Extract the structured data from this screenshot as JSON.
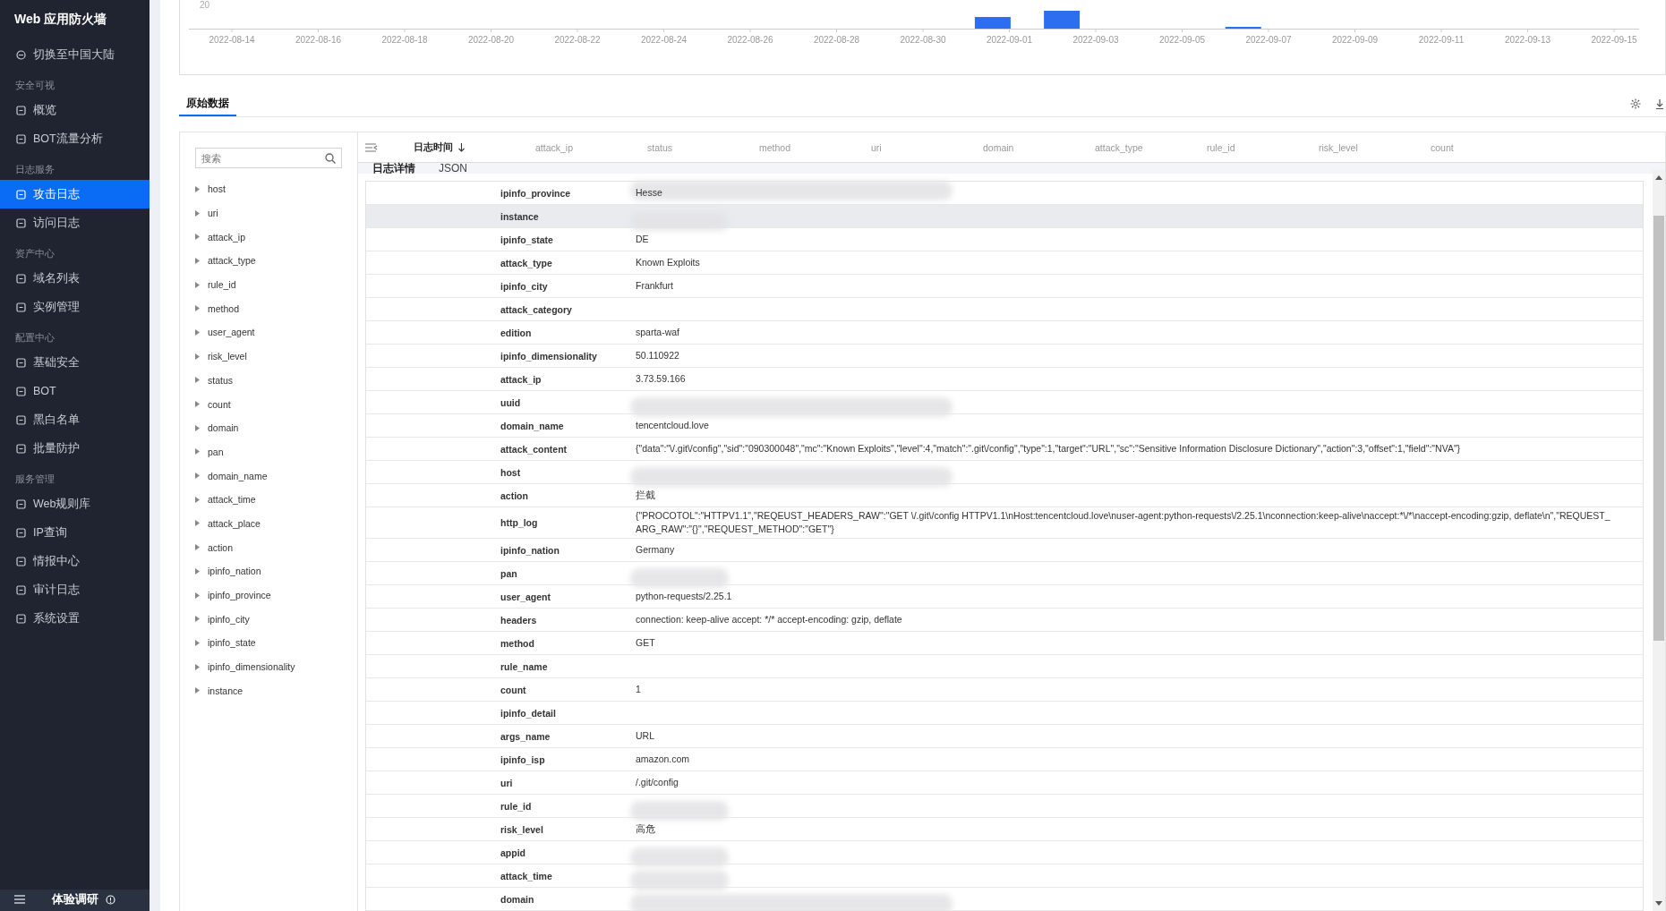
{
  "sidebar": {
    "title": "Web 应用防火墙",
    "switch_link": "切换至中国大陆",
    "groups": [
      {
        "heading": "安全可视",
        "items": [
          {
            "label": "概览",
            "selected": false
          },
          {
            "label": "BOT流量分析",
            "selected": false
          }
        ]
      },
      {
        "heading": "日志服务",
        "items": [
          {
            "label": "攻击日志",
            "selected": true
          },
          {
            "label": "访问日志",
            "selected": false
          }
        ]
      },
      {
        "heading": "资产中心",
        "items": [
          {
            "label": "域名列表",
            "selected": false
          },
          {
            "label": "实例管理",
            "selected": false
          }
        ]
      },
      {
        "heading": "配置中心",
        "items": [
          {
            "label": "基础安全",
            "selected": false
          },
          {
            "label": "BOT",
            "selected": false
          },
          {
            "label": "黑白名单",
            "selected": false
          },
          {
            "label": "批量防护",
            "selected": false
          }
        ]
      },
      {
        "heading": "服务管理",
        "items": [
          {
            "label": "Web规则库",
            "selected": false
          },
          {
            "label": "IP查询",
            "selected": false
          },
          {
            "label": "情报中心",
            "selected": false
          },
          {
            "label": "审计日志",
            "selected": false
          },
          {
            "label": "系统设置",
            "selected": false
          }
        ]
      }
    ],
    "footer": "体验调研"
  },
  "chart": {
    "y_tick": "20",
    "dates": [
      "2022-08-14",
      "2022-08-16",
      "2022-08-18",
      "2022-08-20",
      "2022-08-22",
      "2022-08-24",
      "2022-08-26",
      "2022-08-28",
      "2022-08-30",
      "2022-09-01",
      "2022-09-03",
      "2022-09-05",
      "2022-09-07",
      "2022-09-09",
      "2022-09-11",
      "2022-09-13",
      "2022-09-15"
    ]
  },
  "tabs": [
    {
      "label": "原始数据",
      "selected": true
    }
  ],
  "search": {
    "placeholder": "搜索"
  },
  "fields": [
    "host",
    "uri",
    "attack_ip",
    "attack_type",
    "rule_id",
    "method",
    "user_agent",
    "risk_level",
    "status",
    "count",
    "domain",
    "pan",
    "domain_name",
    "attack_time",
    "attack_place",
    "action",
    "ipinfo_nation",
    "ipinfo_province",
    "ipinfo_city",
    "ipinfo_state",
    "ipinfo_dimensionality",
    "instance"
  ],
  "table": {
    "columns": [
      {
        "label": "日志时间",
        "sorted": true
      },
      {
        "label": "attack_ip",
        "sorted": false
      },
      {
        "label": "status",
        "sorted": false
      },
      {
        "label": "method",
        "sorted": false
      },
      {
        "label": "uri",
        "sorted": false
      },
      {
        "label": "domain",
        "sorted": false
      },
      {
        "label": "attack_type",
        "sorted": false
      },
      {
        "label": "rule_id",
        "sorted": false
      },
      {
        "label": "risk_level",
        "sorted": false
      },
      {
        "label": "count",
        "sorted": false
      }
    ]
  },
  "detail_tabs": [
    {
      "label": "日志详情",
      "selected": true
    },
    {
      "label": "JSON",
      "selected": false
    }
  ],
  "detail_rows": [
    {
      "key": "ipinfo_province",
      "value": "Hesse",
      "redacted": true,
      "highlighted": false
    },
    {
      "key": "instance",
      "redacted": true,
      "highlighted": true
    },
    {
      "key": "ipinfo_state",
      "value": "DE",
      "redacted": false,
      "highlighted": false
    },
    {
      "key": "attack_type",
      "value": "Known Exploits",
      "redacted": false,
      "highlighted": false
    },
    {
      "key": "ipinfo_city",
      "value": "Frankfurt",
      "redacted": false,
      "highlighted": false
    },
    {
      "key": "attack_category",
      "redacted": false,
      "highlighted": false
    },
    {
      "key": "edition",
      "value": "sparta-waf",
      "redacted": false,
      "highlighted": false
    },
    {
      "key": "ipinfo_dimensionality",
      "value": "50.110922",
      "redacted": false,
      "highlighted": false
    },
    {
      "key": "attack_ip",
      "value": "3.73.59.166",
      "redacted": false,
      "highlighted": false
    },
    {
      "key": "uuid",
      "redacted": true,
      "highlighted": false
    },
    {
      "key": "domain_name",
      "value": "tencentcloud.love",
      "redacted": false,
      "highlighted": false
    },
    {
      "key": "attack_content",
      "value": "{\"data\":\"\\/.git\\/config\",\"sid\":\"090300048\",\"mc\":\"Known Exploits\",\"level\":4,\"match\":\".git\\/config\",\"type\":1,\"target\":\"URL\",\"sc\":\"Sensitive Information Disclosure Dictionary\",\"action\":3,\"offset\":1,\"field\":\"NVA\"}",
      "redacted": false,
      "highlighted": false
    },
    {
      "key": "host",
      "redacted": true,
      "highlighted": false
    },
    {
      "key": "action",
      "value": "拦截",
      "redacted": false,
      "highlighted": false
    },
    {
      "key": "http_log",
      "value": "{\"PROCOTOL\":\"HTTPV1.1\",\"REQEUST_HEADERS_RAW\":\"GET \\/.git\\/config HTTPV1.1\\nHost:tencentcloud.love\\nuser-agent:python-requests\\/2.25.1\\nconnection:keep-alive\\naccept:*\\/*\\naccept-encoding:gzip, deflate\\n\",\"REQUEST_ARG_RAW\":\"{}\",\"REQUEST_METHOD\":\"GET\"}",
      "redacted": false,
      "highlighted": false
    },
    {
      "key": "ipinfo_nation",
      "value": "Germany",
      "redacted": false,
      "highlighted": false
    },
    {
      "key": "pan",
      "redacted": true,
      "highlighted": false
    },
    {
      "key": "user_agent",
      "value": "python-requests/2.25.1",
      "redacted": false,
      "highlighted": false
    },
    {
      "key": "headers",
      "value": "connection: keep-alive accept: */* accept-encoding: gzip, deflate",
      "redacted": false,
      "highlighted": false
    },
    {
      "key": "method",
      "value": "GET",
      "redacted": false,
      "highlighted": false
    },
    {
      "key": "rule_name",
      "redacted": false,
      "highlighted": false
    },
    {
      "key": "count",
      "value": "1",
      "redacted": false,
      "highlighted": false
    },
    {
      "key": "ipinfo_detail",
      "redacted": false,
      "highlighted": false
    },
    {
      "key": "args_name",
      "value": "URL",
      "redacted": false,
      "highlighted": false
    },
    {
      "key": "ipinfo_isp",
      "value": "amazon.com",
      "redacted": false,
      "highlighted": false
    },
    {
      "key": "uri",
      "value": "/.git/config",
      "redacted": false,
      "highlighted": false
    },
    {
      "key": "rule_id",
      "redacted": true,
      "highlighted": false
    },
    {
      "key": "risk_level",
      "value": "高危",
      "redacted": false,
      "highlighted": false
    },
    {
      "key": "appid",
      "redacted": true,
      "highlighted": false
    },
    {
      "key": "attack_time",
      "redacted": true,
      "highlighted": false
    },
    {
      "key": "domain",
      "redacted": true,
      "highlighted": false
    }
  ]
}
